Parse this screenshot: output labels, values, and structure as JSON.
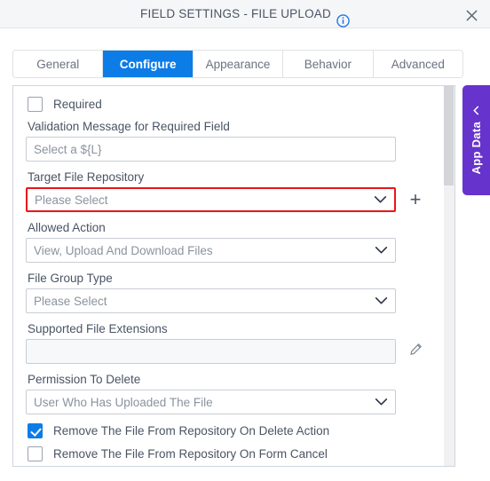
{
  "titlebar": {
    "title": "FIELD SETTINGS - FILE UPLOAD",
    "info_icon": "info-circle-icon",
    "close_icon": "close-icon",
    "accent_color": "#0c7ce6"
  },
  "tabs": [
    {
      "label": "General",
      "active": false
    },
    {
      "label": "Configure",
      "active": true
    },
    {
      "label": "Appearance",
      "active": false
    },
    {
      "label": "Behavior",
      "active": false
    },
    {
      "label": "Advanced",
      "active": false
    }
  ],
  "side_panel": {
    "label": "App Data",
    "chevron_icon": "chevron-left-icon",
    "color": "#6633cc"
  },
  "form": {
    "required_checkbox": {
      "label": "Required",
      "checked": false
    },
    "validation_message": {
      "label": "Validation Message for Required Field",
      "value": "Select a ${L}"
    },
    "target_file_repository": {
      "label": "Target File Repository",
      "value": "Please Select",
      "error": true,
      "error_color": "#e8161a",
      "add_icon": "plus-icon"
    },
    "allowed_action": {
      "label": "Allowed Action",
      "value": "View, Upload And Download Files"
    },
    "file_group_type": {
      "label": "File Group Type",
      "value": "Please Select"
    },
    "supported_file_extensions": {
      "label": "Supported File Extensions",
      "value": "",
      "edit_icon": "pencil-icon"
    },
    "permission_to_delete": {
      "label": "Permission To Delete",
      "value": "User Who Has Uploaded The File"
    },
    "remove_on_delete": {
      "label": "Remove The File From Repository On Delete Action",
      "checked": true
    },
    "remove_on_cancel": {
      "label": "Remove The File From Repository On Form Cancel",
      "checked": false
    }
  }
}
